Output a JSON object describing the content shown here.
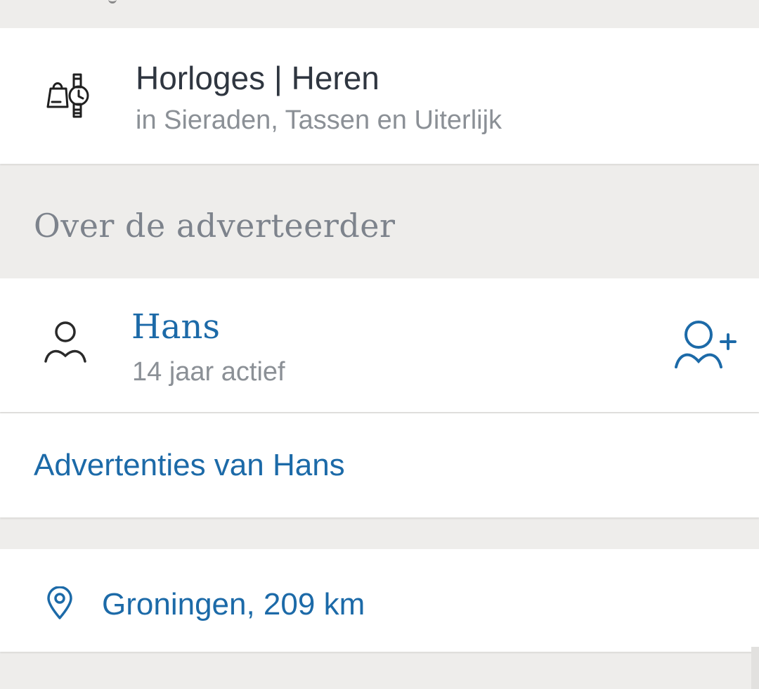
{
  "category": {
    "icon": "watch-and-bag-icon",
    "title": "Horloges | Heren",
    "subtitle": "in Sieraden, Tassen en Uiterlijk"
  },
  "advertiser_section": {
    "title": "Over de adverteerder"
  },
  "advertiser": {
    "icon": "user-icon",
    "name": "Hans",
    "active_since": "14 jaar actief",
    "follow_icon": "add-user-icon"
  },
  "ads_link": {
    "label": "Advertenties van Hans"
  },
  "location": {
    "icon": "location-pin-icon",
    "label": "Groningen, 209 km"
  },
  "colors": {
    "accent": "#1c6aa8",
    "text_primary": "#2f3640",
    "text_secondary": "#8b9096",
    "background": "#eeedeb",
    "card": "#ffffff"
  }
}
